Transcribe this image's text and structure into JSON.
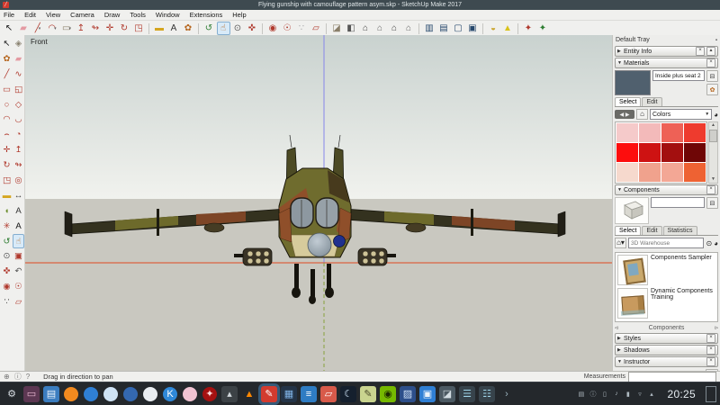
{
  "window": {
    "title": "Flying gunship with camouflage pattern asym.skp - SketchUp Make 2017",
    "logo_glyph": "╱"
  },
  "menu_bar": {
    "items": [
      "File",
      "Edit",
      "View",
      "Camera",
      "Draw",
      "Tools",
      "Window",
      "Extensions",
      "Help"
    ]
  },
  "top_toolbar": {
    "items": [
      {
        "n": "select-tool-icon",
        "g": "↖",
        "c": "#1a1a1a"
      },
      {
        "n": "eraser-tool-icon",
        "g": "▰",
        "c": "#e49aa2"
      },
      {
        "n": "line-tool-icon",
        "g": "╱",
        "c": "#b03a2e",
        "cls": "dd"
      },
      {
        "n": "arc-tool-icon",
        "g": "◠",
        "c": "#b03a2e",
        "cls": "dd"
      },
      {
        "n": "rectangle-tool-icon",
        "g": "▭",
        "c": "#8a7f6a",
        "cls": "dd"
      },
      {
        "n": "push-pull-tool-icon",
        "g": "↥",
        "c": "#b03a2e"
      },
      {
        "n": "follow-me-tool-icon",
        "g": "↬",
        "c": "#b03a2e"
      },
      {
        "n": "move-tool-icon",
        "g": "✛",
        "c": "#b03a2e"
      },
      {
        "n": "rotate-tool-icon",
        "g": "↻",
        "c": "#b03a2e"
      },
      {
        "n": "scale-tool-icon",
        "g": "◳",
        "c": "#b03a2e"
      },
      {
        "cls": "sep"
      },
      {
        "n": "tape-measure-tool-icon",
        "g": "▬",
        "c": "#d5a620"
      },
      {
        "n": "text-tool-icon",
        "g": "A",
        "c": "#333333"
      },
      {
        "n": "paint-bucket-tool-icon",
        "g": "✿",
        "c": "#b5651d"
      },
      {
        "cls": "sep"
      },
      {
        "n": "orbit-tool-icon",
        "g": "↺",
        "c": "#2e7d32"
      },
      {
        "n": "pan-tool-icon",
        "g": "☝",
        "c": "#b5651d",
        "cls": "active"
      },
      {
        "n": "zoom-tool-icon",
        "g": "⊙",
        "c": "#555555"
      },
      {
        "n": "zoom-extents-icon",
        "g": "✜",
        "c": "#b03a2e"
      },
      {
        "cls": "sep"
      },
      {
        "n": "position-camera-icon",
        "g": "◉",
        "c": "#b03a2e"
      },
      {
        "n": "look-around-icon",
        "g": "☉",
        "c": "#b03a2e"
      },
      {
        "n": "walk-tool-icon",
        "g": "∵",
        "c": "#aaaaaa"
      },
      {
        "n": "section-plane-icon",
        "g": "▱",
        "c": "#b03a2e"
      },
      {
        "cls": "sep"
      },
      {
        "n": "iso-view-icon",
        "g": "◪",
        "c": "#8a7f6a"
      },
      {
        "n": "top-view-icon",
        "g": "◧",
        "c": "#555555"
      },
      {
        "n": "front-view-icon",
        "g": "⌂",
        "c": "#444444"
      },
      {
        "n": "right-view-icon",
        "g": "⌂",
        "c": "#666666"
      },
      {
        "n": "left-view-icon",
        "g": "⌂",
        "c": "#444444"
      },
      {
        "n": "back-view-icon",
        "g": "⌂",
        "c": "#666666"
      },
      {
        "cls": "sep"
      },
      {
        "n": "xray-style-icon",
        "g": "▥",
        "c": "#27496d"
      },
      {
        "n": "wireframe-style-icon",
        "g": "▤",
        "c": "#27496d"
      },
      {
        "n": "hidden-line-style-icon",
        "g": "▢",
        "c": "#27496d"
      },
      {
        "n": "shaded-style-icon",
        "g": "▣",
        "c": "#27496d"
      },
      {
        "cls": "sep"
      },
      {
        "n": "shadows-toggle-icon",
        "g": "◒",
        "c": "#c9a227"
      },
      {
        "n": "fog-toggle-icon",
        "g": "▲",
        "c": "#d9c21a"
      },
      {
        "cls": "sep"
      },
      {
        "n": "add-location-icon",
        "g": "✦",
        "c": "#b03a2e"
      },
      {
        "n": "photo-textures-icon",
        "g": "✦",
        "c": "#2e7d32"
      }
    ]
  },
  "left_toolbar": {
    "tools": [
      {
        "n": "select-tool",
        "g": "↖",
        "c": "#1a1a1a"
      },
      {
        "n": "make-component-tool",
        "g": "◈",
        "c": "#8a8270"
      },
      {
        "n": "paint-bucket-tool",
        "g": "✿",
        "c": "#b5651d"
      },
      {
        "n": "eraser-tool",
        "g": "▰",
        "c": "#e49aa2"
      },
      {
        "n": "line-tool",
        "g": "╱",
        "c": "#b03a2e"
      },
      {
        "n": "freehand-tool",
        "g": "∿",
        "c": "#b03a2e"
      },
      {
        "n": "rectangle-tool",
        "g": "▭",
        "c": "#b03a2e"
      },
      {
        "n": "rotated-rectangle-tool",
        "g": "◱",
        "c": "#b03a2e"
      },
      {
        "n": "circle-tool",
        "g": "○",
        "c": "#b03a2e"
      },
      {
        "n": "polygon-tool",
        "g": "◇",
        "c": "#b03a2e"
      },
      {
        "n": "arc-tool",
        "g": "◠",
        "c": "#b03a2e"
      },
      {
        "n": "two-point-arc-tool",
        "g": "◡",
        "c": "#b03a2e"
      },
      {
        "n": "three-point-arc-tool",
        "g": "⌢",
        "c": "#b03a2e"
      },
      {
        "n": "pie-tool",
        "g": "◔",
        "c": "#b03a2e"
      },
      {
        "n": "move-tool",
        "g": "✛",
        "c": "#b03a2e"
      },
      {
        "n": "push-pull-tool",
        "g": "↥",
        "c": "#b03a2e"
      },
      {
        "n": "rotate-tool",
        "g": "↻",
        "c": "#b03a2e"
      },
      {
        "n": "follow-me-tool",
        "g": "↬",
        "c": "#b03a2e"
      },
      {
        "n": "scale-tool",
        "g": "◳",
        "c": "#b03a2e"
      },
      {
        "n": "offset-tool",
        "g": "◎",
        "c": "#b03a2e"
      },
      {
        "n": "tape-measure-tool",
        "g": "▬",
        "c": "#d5a620"
      },
      {
        "n": "dimension-tool",
        "g": "↔",
        "c": "#333333"
      },
      {
        "n": "protractor-tool",
        "g": "◖",
        "c": "#6d8f2f"
      },
      {
        "n": "text-tool",
        "g": "A",
        "c": "#333333"
      },
      {
        "n": "axes-tool",
        "g": "✳",
        "c": "#b03a2e"
      },
      {
        "n": "threed-text-tool",
        "g": "A",
        "c": "#111111"
      },
      {
        "n": "orbit-tool",
        "g": "↺",
        "c": "#2e7d32"
      },
      {
        "n": "pan-tool",
        "g": "☝",
        "c": "#b5651d",
        "cls": "active"
      },
      {
        "n": "zoom-tool",
        "g": "⊙",
        "c": "#555555"
      },
      {
        "n": "zoom-window-tool",
        "g": "▣",
        "c": "#b03a2e"
      },
      {
        "n": "zoom-extents-tool",
        "g": "✜",
        "c": "#b03a2e"
      },
      {
        "n": "previous-view-tool",
        "g": "↶",
        "c": "#555555"
      },
      {
        "n": "position-camera-tool",
        "g": "◉",
        "c": "#b03a2e"
      },
      {
        "n": "look-around-tool",
        "g": "☉",
        "c": "#b03a2e"
      },
      {
        "n": "walk-tool",
        "g": "∵",
        "c": "#555555"
      },
      {
        "n": "section-plane-tool",
        "g": "▱",
        "c": "#b03a2e"
      }
    ]
  },
  "viewport": {
    "view_label": "Front",
    "axis_colors": {
      "red": "#e04a22",
      "blue": "#8686ea",
      "green": "#86a23c"
    },
    "sky_top": "#c9d2cf",
    "sky_bottom": "#f1f2ee",
    "ground": "#c9c8c0"
  },
  "tray": {
    "title": "Default Tray",
    "entity_info": {
      "label": "Entity Info"
    },
    "materials": {
      "label": "Materials",
      "preview_style": "background:#50606e",
      "name_value": "Inside plus seat 2",
      "tabs": [
        {
          "label": "Select",
          "cls": "active"
        },
        {
          "label": "Edit"
        }
      ],
      "dropdown_value": "Colors",
      "swatches": [
        "#f5caca",
        "#f3baba",
        "#ee6156",
        "#ee3b2e",
        "#fd0d0d",
        "#ce1212",
        "#a30f0f",
        "#6f0606",
        "#f6d9cd",
        "#f0a28d",
        "#f3a795",
        "#ee6233"
      ]
    },
    "components": {
      "label": "Components",
      "name_value": "",
      "tabs": [
        {
          "label": "Select",
          "cls": "active"
        },
        {
          "label": "Edit"
        },
        {
          "label": "Statistics"
        }
      ],
      "search_placeholder": "3D Warehouse",
      "items": [
        {
          "label": "Components Sampler",
          "cls": "thumb-sampler"
        },
        {
          "label": "Dynamic Components Training",
          "cls": "thumb-training"
        }
      ],
      "nav_label": "Components"
    },
    "styles": {
      "label": "Styles"
    },
    "shadows": {
      "label": "Shadows"
    },
    "instructor": {
      "label": "Instructor"
    }
  },
  "status_bar": {
    "icons": [
      {
        "n": "geolocation-icon",
        "g": "⊕"
      },
      {
        "n": "credits-icon",
        "g": "ⓘ"
      },
      {
        "n": "help-icon",
        "g": "?"
      }
    ],
    "hint": "Drag in direction to pan",
    "measurements_label": "Measurements",
    "measurements_value": ""
  },
  "taskbar": {
    "apps": [
      {
        "n": "start-menu-button",
        "g": "⚙",
        "fg": "#d6dde2",
        "cls": "plain"
      },
      {
        "n": "screen-tool-app",
        "g": "▭",
        "fg": "#e8b7d0",
        "bg": "#5c3752"
      },
      {
        "n": "file-manager-app",
        "g": "▤",
        "fg": "#eaf3fb",
        "bg": "#3b7dbf"
      },
      {
        "n": "firefox-app",
        "g": "",
        "bg": "#f28a1f",
        "cls": "round"
      },
      {
        "n": "edge-app",
        "g": "",
        "bg": "#2f7fd4",
        "cls": "round"
      },
      {
        "n": "browser-light-app",
        "g": "",
        "bg": "#cfe3f5",
        "cls": "round"
      },
      {
        "n": "globe-app",
        "g": "",
        "bg": "#3468b0",
        "cls": "round"
      },
      {
        "n": "chat-app",
        "g": "",
        "bg": "#e9edf1",
        "cls": "round"
      },
      {
        "n": "k-connect-app",
        "g": "K",
        "fg": "#ffffff",
        "bg": "#2f88d8",
        "cls": "round"
      },
      {
        "n": "media-app",
        "g": "",
        "bg": "#f0c3d2",
        "cls": "round"
      },
      {
        "n": "wine-app",
        "g": "✦",
        "fg": "#ffd9d9",
        "bg": "#a51111",
        "cls": "round"
      },
      {
        "n": "utility-app",
        "g": "▴",
        "fg": "#cfd6da",
        "bg": "#3c4246"
      },
      {
        "n": "vlc-app",
        "g": "▲",
        "fg": "#ff8800",
        "cls": "plain"
      },
      {
        "n": "sketchup-app",
        "g": "✎",
        "fg": "#ffffff",
        "bg": "#d23b2f",
        "cls": "active"
      },
      {
        "n": "image-editor-app",
        "g": "▦",
        "fg": "#7fb2e5",
        "bg": "#243447"
      },
      {
        "n": "text-editor-app",
        "g": "≡",
        "fg": "#ffffff",
        "bg": "#2e7cc3"
      },
      {
        "n": "pdf-viewer-app",
        "g": "▱",
        "fg": "#ffffff",
        "bg": "#d85a4a"
      },
      {
        "n": "night-color-app",
        "g": "☾",
        "fg": "#cfe3f5",
        "bg": "#15202e"
      },
      {
        "n": "notes-app",
        "g": "✎",
        "fg": "#4a4a2a",
        "bg": "#c9d48f"
      },
      {
        "n": "nvidia-settings-app",
        "g": "◉",
        "fg": "#1d2a00",
        "bg": "#76b900"
      },
      {
        "n": "photo-manager-app",
        "g": "▨",
        "fg": "#cfe0f5",
        "bg": "#2d4f8a"
      },
      {
        "n": "app-store-app",
        "g": "▣",
        "fg": "#eaf3fb",
        "bg": "#2f7fd4"
      },
      {
        "n": "gallery-app",
        "g": "◪",
        "fg": "#d3dde2",
        "bg": "#4c5a63"
      },
      {
        "n": "system-monitor-app",
        "g": "☰",
        "fg": "#9fd4e8",
        "bg": "#37434b"
      },
      {
        "n": "display-settings-app",
        "g": "☷",
        "fg": "#9fd4e8",
        "bg": "#37434b"
      },
      {
        "n": "panel-overflow-chevron",
        "g": "›",
        "fg": "#9ab2bd",
        "cls": "plain"
      }
    ],
    "tray_icons": [
      {
        "n": "tray-keyboard-icon",
        "g": "▤"
      },
      {
        "n": "tray-info-icon",
        "g": "ⓘ"
      },
      {
        "n": "tray-usb-icon",
        "g": "▯"
      },
      {
        "n": "tray-volume-icon",
        "g": "♪"
      },
      {
        "n": "tray-battery-icon",
        "g": "▮"
      },
      {
        "n": "tray-network-icon",
        "g": "▿"
      },
      {
        "n": "tray-expand-icon",
        "g": "▴"
      }
    ],
    "clock": "20:25"
  }
}
